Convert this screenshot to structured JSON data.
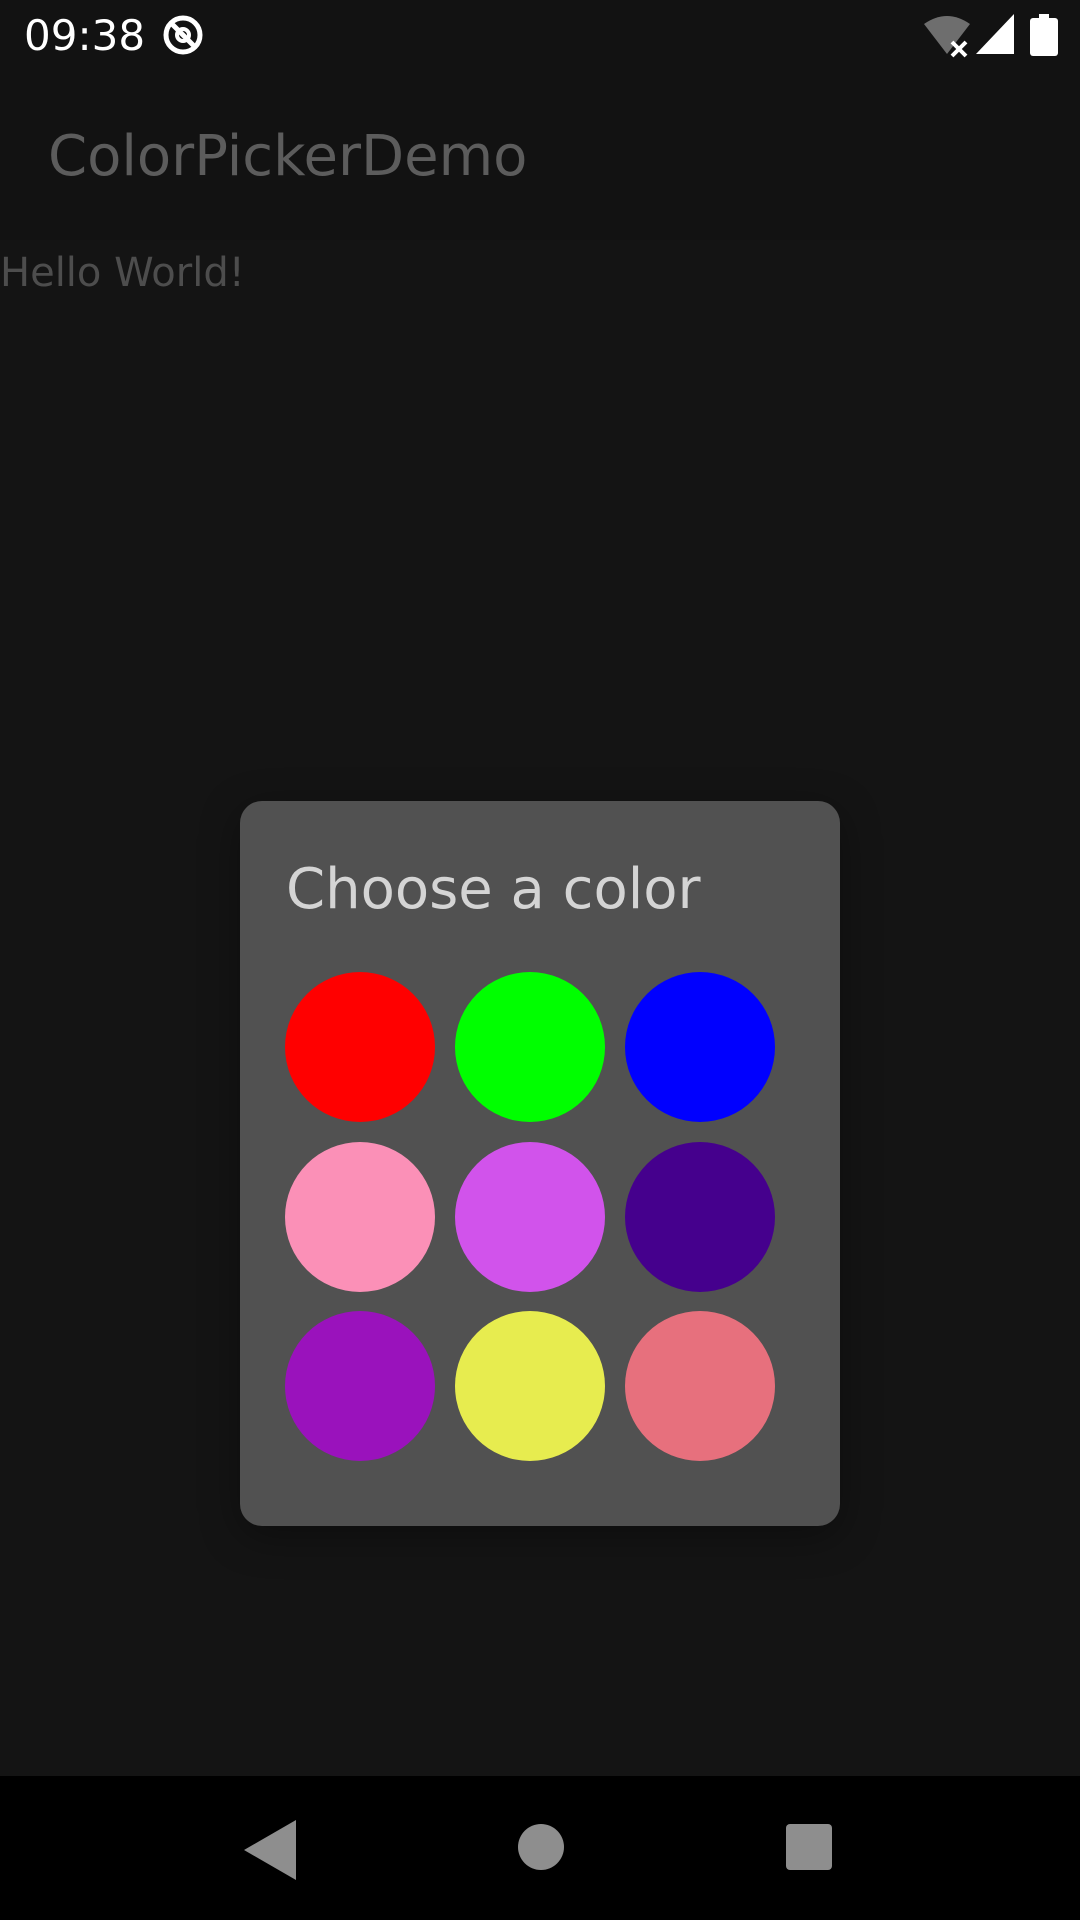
{
  "status_bar": {
    "time": "09:38",
    "icons": [
      "do-not-disturb-icon",
      "wifi-off-icon",
      "cell-signal-icon",
      "battery-icon"
    ]
  },
  "app_bar": {
    "title": "ColorPickerDemo"
  },
  "main": {
    "text": "Hello World!"
  },
  "dialog": {
    "title": "Choose a color",
    "swatches": [
      {
        "color": "#ff0000"
      },
      {
        "color": "#00ff00"
      },
      {
        "color": "#0000ff"
      },
      {
        "color": "#fb90b7"
      },
      {
        "color": "#d153eb"
      },
      {
        "color": "#45008d"
      },
      {
        "color": "#9a12bc"
      },
      {
        "color": "#e7ec4f"
      },
      {
        "color": "#e7707d"
      }
    ]
  },
  "nav_bar": {
    "icons": [
      "back-icon",
      "home-icon",
      "recents-icon"
    ]
  },
  "colors": {
    "background": "#141414",
    "bars": "#121212",
    "dialog": "#515151",
    "nav_bar": "#000000"
  }
}
